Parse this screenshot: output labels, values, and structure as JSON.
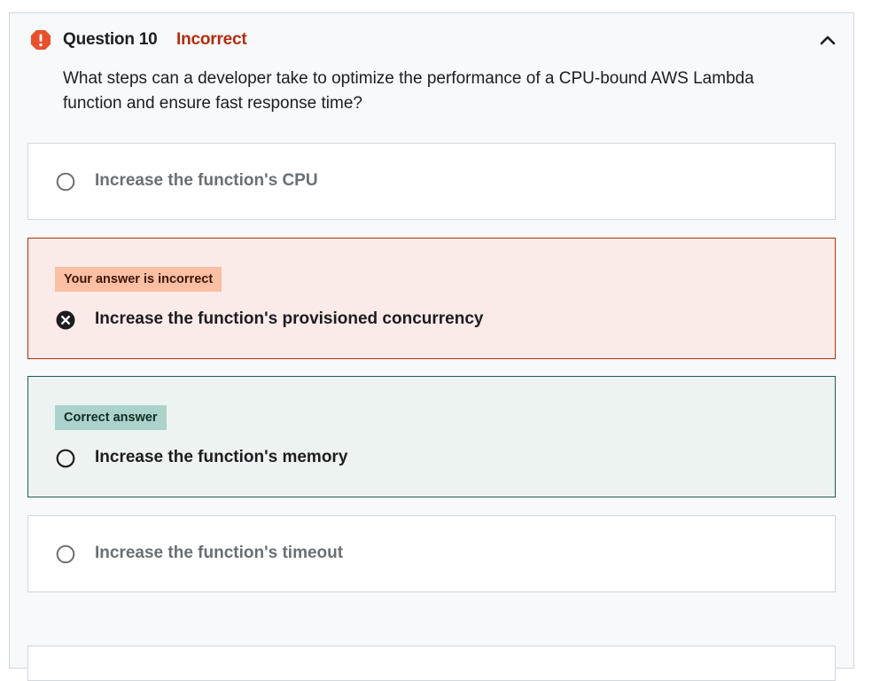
{
  "question": {
    "number_label": "Question 10",
    "status_label": "Incorrect",
    "text": "What steps can a developer take to optimize the performance of a CPU-bound AWS Lambda function and ensure fast response time?"
  },
  "icons": {
    "status": "alert-icon",
    "collapse": "chevron-up-icon",
    "selected_wrong": "x-circle-icon",
    "radio": "radio-empty-icon"
  },
  "options": [
    {
      "label": "Increase the function's CPU",
      "state": "unselected"
    },
    {
      "label": "Increase the function's provisioned concurrency",
      "state": "incorrect",
      "badge": "Your answer is incorrect"
    },
    {
      "label": "Increase the function's memory",
      "state": "correct",
      "badge": "Correct answer"
    },
    {
      "label": "Increase the function's timeout",
      "state": "unselected"
    }
  ],
  "colors": {
    "incorrect_accent": "#b32d0f",
    "incorrect_bg": "#fbebe8",
    "incorrect_badge_bg": "#fbbfa4",
    "correct_accent": "#1e6055",
    "correct_bg": "#edf3f1",
    "correct_badge_bg": "#acd2cc",
    "alert_icon": "#e8502c"
  }
}
